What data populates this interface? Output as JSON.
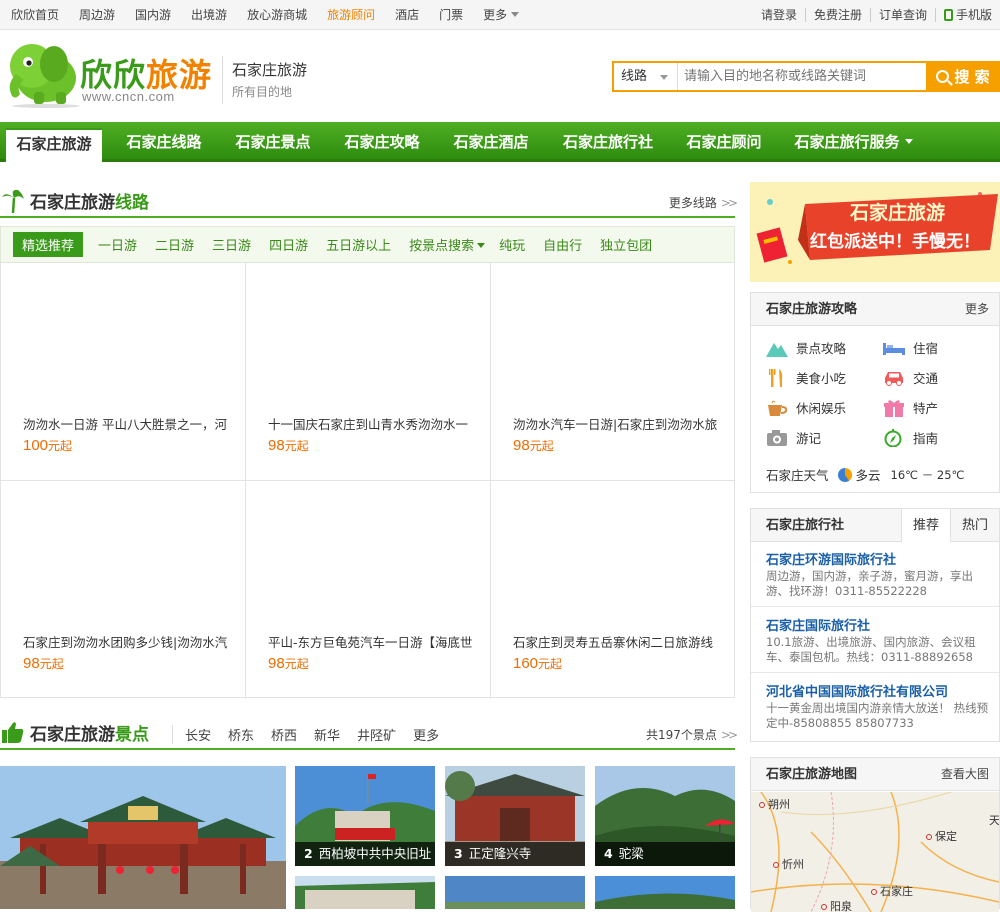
{
  "topnav": {
    "items": [
      "欣欣首页",
      "周边游",
      "国内游",
      "出境游",
      "放心游商城",
      "旅游顾问",
      "酒店",
      "门票",
      "更多"
    ],
    "active_index": 5,
    "right": [
      "请登录",
      "免费注册",
      "订单查询",
      "手机版"
    ]
  },
  "header": {
    "logo_cn_green": "欣欣",
    "logo_cn_orange": "旅游",
    "logo_url": "www.cncn.com",
    "city_title": "石家庄旅游",
    "city_sub": "所有目的地"
  },
  "search": {
    "type_selected": "线路",
    "placeholder": "请输入目的地名称或线路关键词",
    "button": "搜 索"
  },
  "mainnav": {
    "items": [
      "石家庄旅游",
      "石家庄线路",
      "石家庄景点",
      "石家庄攻略",
      "石家庄酒店",
      "石家庄旅行社",
      "石家庄顾问",
      "石家庄旅行服务"
    ],
    "active_index": 0
  },
  "routes_section": {
    "title_prefix": "石家庄旅游",
    "title_highlight": "线路",
    "more": "更多线路",
    "filters": [
      "精选推荐",
      "一日游",
      "二日游",
      "三日游",
      "四日游",
      "五日游以上",
      "按景点搜索",
      "纯玩",
      "自由行",
      "独立包团"
    ],
    "active_filter": 0,
    "items": [
      {
        "title": "沕沕水一日游 平山八大胜景之一，河",
        "price": "100",
        "unit": "元起"
      },
      {
        "title": "十一国庆石家庄到山青水秀沕沕水一",
        "price": "98",
        "unit": "元起"
      },
      {
        "title": "沕沕水汽车一日游|石家庄到沕沕水旅",
        "price": "98",
        "unit": "元起"
      },
      {
        "title": "石家庄到沕沕水团购多少钱|沕沕水汽",
        "price": "98",
        "unit": "元起"
      },
      {
        "title": "平山-东方巨龟苑汽车一日游【海底世",
        "price": "98",
        "unit": "元起"
      },
      {
        "title": "石家庄到灵寿五岳寨休闲二日旅游线",
        "price": "160",
        "unit": "元起"
      }
    ]
  },
  "spots_section": {
    "title_prefix": "石家庄旅游",
    "title_highlight": "景点",
    "districts": [
      "长安",
      "桥东",
      "桥西",
      "新华",
      "井陉矿",
      "更多"
    ],
    "count": "共197个景点",
    "thumbs": [
      {
        "num": "2",
        "name": "西柏坡中共中央旧址"
      },
      {
        "num": "3",
        "name": "正定隆兴寺"
      },
      {
        "num": "4",
        "name": "驼梁"
      }
    ]
  },
  "banner": {
    "line1": "石家庄旅游",
    "line2": "红包派送中！手慢无！"
  },
  "guide_panel": {
    "title": "石家庄旅游攻略",
    "more": "更多",
    "items": [
      {
        "label": "景点攻略",
        "icon": "mountain-icon"
      },
      {
        "label": "住宿",
        "icon": "bed-icon"
      },
      {
        "label": "美食小吃",
        "icon": "fork-knife-icon"
      },
      {
        "label": "交通",
        "icon": "car-icon"
      },
      {
        "label": "休闲娱乐",
        "icon": "coffee-icon"
      },
      {
        "label": "特产",
        "icon": "gift-icon"
      },
      {
        "label": "游记",
        "icon": "camera-icon"
      },
      {
        "label": "指南",
        "icon": "compass-icon"
      }
    ],
    "weather_label": "石家庄天气",
    "weather_desc": "多云",
    "temp": "16℃ － 25℃"
  },
  "agency_panel": {
    "title": "石家庄旅行社",
    "tabs": [
      "推荐",
      "热门"
    ],
    "active_tab": 0,
    "items": [
      {
        "name": "石家庄环游国际旅行社",
        "desc": "周边游，国内游，亲子游，蜜月游，享出游、找环游！0311-85522228"
      },
      {
        "name": "石家庄国际旅行社",
        "desc": "10.1旅游、出境旅游、国内旅游、会议租车、泰国包机。热线：0311-88892658"
      },
      {
        "name": "河北省中国国际旅行社有限公司",
        "desc": "十一黄金周出境国内游亲情大放送！ 热线预定中-85808855 85807733"
      }
    ]
  },
  "map_panel": {
    "title": "石家庄旅游地图",
    "more": "查看大图",
    "places": [
      "朔州",
      "保定",
      "忻州",
      "石家庄",
      "阳泉",
      "天"
    ]
  },
  "colors": {
    "brand_green": "#3a9a1a",
    "accent_orange": "#f08200",
    "search_orange": "#f6a000",
    "link_blue": "#1a5fa8"
  }
}
